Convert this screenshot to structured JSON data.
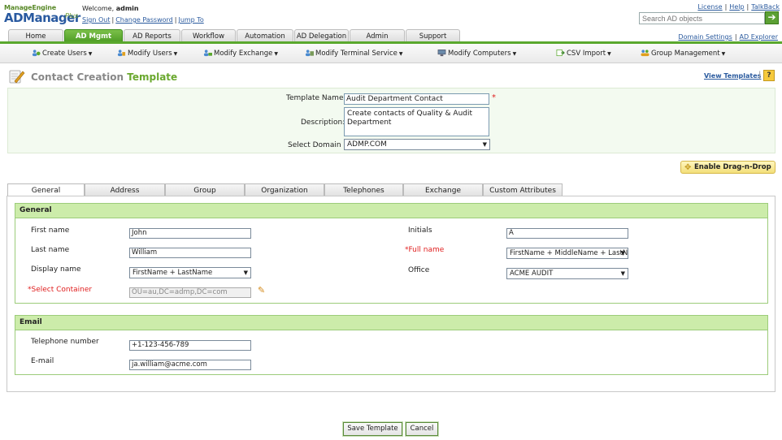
{
  "header": {
    "brand_top": "ManageEngine",
    "brand_main": "ADManager",
    "brand_plus": "Plus",
    "welcome_text": "Welcome,",
    "username": "admin",
    "sign_out": "Sign Out",
    "change_password": "Change Password",
    "jump_to": "Jump To",
    "license": "License",
    "help": "Help",
    "talkback": "TalkBack",
    "search_placeholder": "Search AD objects"
  },
  "main_tabs": [
    {
      "label": "Home"
    },
    {
      "label": "AD Mgmt"
    },
    {
      "label": "AD Reports"
    },
    {
      "label": "Workflow"
    },
    {
      "label": "Automation"
    },
    {
      "label": "AD Delegation"
    },
    {
      "label": "Admin"
    },
    {
      "label": "Support"
    }
  ],
  "right_links": {
    "domain_settings": "Domain Settings",
    "ad_explorer": "AD Explorer"
  },
  "submenu": [
    {
      "label": "Create Users"
    },
    {
      "label": "Modify Users"
    },
    {
      "label": "Modify Exchange"
    },
    {
      "label": "Modify Terminal Service"
    },
    {
      "label": "Modify Computers"
    },
    {
      "label": "CSV Import"
    },
    {
      "label": "Group Management"
    }
  ],
  "page": {
    "title_part1": "Contact Creation",
    "title_part2": "Template",
    "view_templates": "View Templates",
    "help_label": "?"
  },
  "template": {
    "name_label": "Template Name:",
    "name_value": "Audit Department Contact",
    "description_label": "Description:",
    "description_value": "Create contacts of Quality & Audit Department",
    "domain_label": "Select Domain :",
    "domain_value": "ADMP.COM"
  },
  "dnd_button": "Enable Drag-n-Drop",
  "form_tabs": [
    {
      "label": "General"
    },
    {
      "label": "Address"
    },
    {
      "label": "Group"
    },
    {
      "label": "Organization"
    },
    {
      "label": "Telephones"
    },
    {
      "label": "Exchange"
    },
    {
      "label": "Custom Attributes"
    }
  ],
  "general": {
    "heading": "General",
    "first_name_label": "First name",
    "first_name_value": "John",
    "last_name_label": "Last name",
    "last_name_value": "William",
    "display_name_label": "Display name",
    "display_name_value": "FirstName + LastName",
    "container_label": "Select Container",
    "container_value": "OU=au,DC=admp,DC=com",
    "initials_label": "Initials",
    "initials_value": "A",
    "full_name_label": "Full name",
    "full_name_value": "FirstName + MiddleName + LastN",
    "office_label": "Office",
    "office_value": "ACME AUDIT"
  },
  "email": {
    "heading": "Email",
    "telephone_label": "Telephone number",
    "telephone_value": "+1-123-456-789",
    "email_label": "E-mail",
    "email_value": "ja.william@acme.com"
  },
  "buttons": {
    "save": "Save Template",
    "cancel": "Cancel"
  },
  "colors": {
    "accent": "#5aa82e",
    "section_head": "#ccecaa",
    "required": "#e02020",
    "link": "#2a5a9e"
  }
}
